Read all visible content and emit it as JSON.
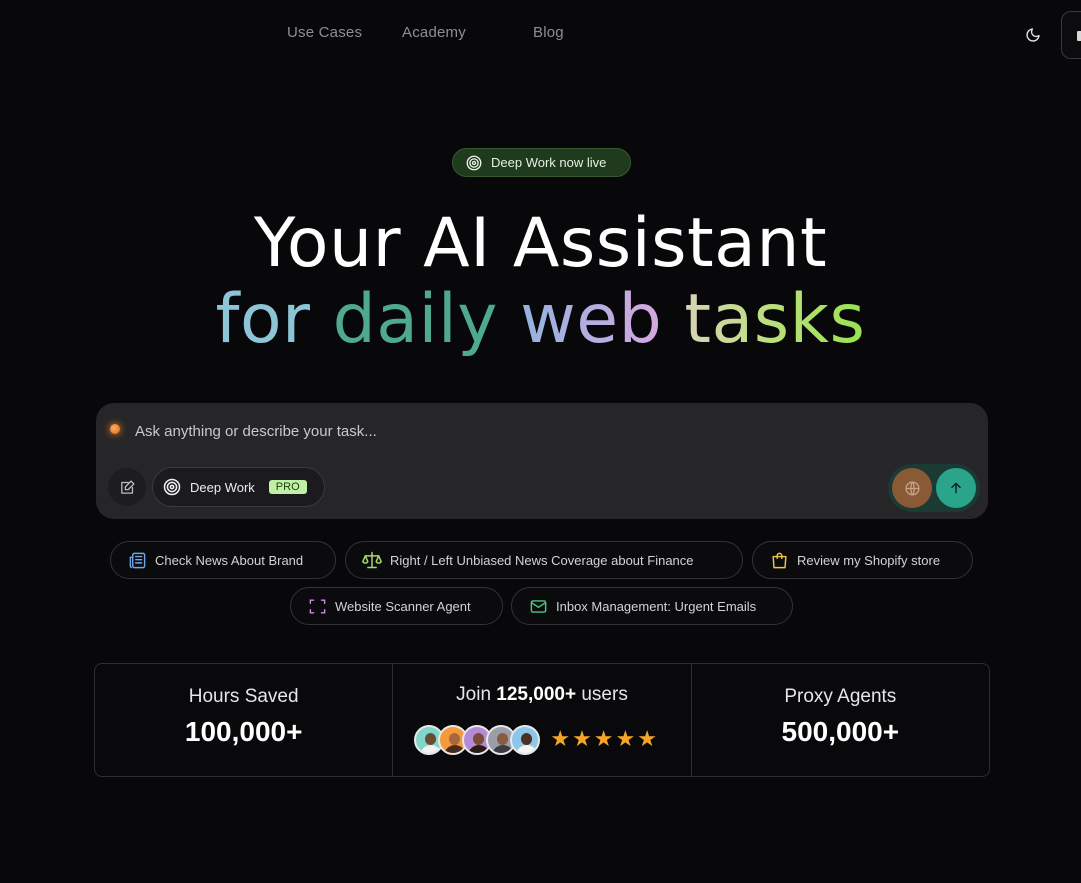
{
  "nav": {
    "links": [
      "Use Cases",
      "Academy",
      "Blog"
    ]
  },
  "badge": {
    "label": "Deep Work now live"
  },
  "hero": {
    "line1": "Your AI Assistant",
    "line2_words": [
      "for",
      "daily",
      "web",
      "tasks"
    ]
  },
  "prompt": {
    "placeholder": "Ask anything or describe your task...",
    "deep_work_label": "Deep Work",
    "pro_tag": "PRO"
  },
  "chips": [
    {
      "label": "Check News About Brand",
      "icon": "newspaper-icon"
    },
    {
      "label": "Right / Left Unbiased News Coverage about Finance",
      "icon": "scale-icon"
    },
    {
      "label": "Review my Shopify store",
      "icon": "shopping-bag-icon"
    },
    {
      "label": "Website Scanner Agent",
      "icon": "scan-frame-icon"
    },
    {
      "label": "Inbox Management: Urgent Emails",
      "icon": "mail-icon"
    }
  ],
  "stats": {
    "hours_label": "Hours Saved",
    "hours_value": "100,000+",
    "join_prefix": "Join",
    "join_count": "125,000+",
    "join_suffix": "users",
    "rating_stars": 5,
    "agents_label": "Proxy Agents",
    "agents_value": "500,000+"
  },
  "colors": {
    "background": "#08080a",
    "badge_bg": "#1f3a1d",
    "send_button": "#2aa58c",
    "star": "#f5a524",
    "pro_tag": "#bff0a3"
  }
}
